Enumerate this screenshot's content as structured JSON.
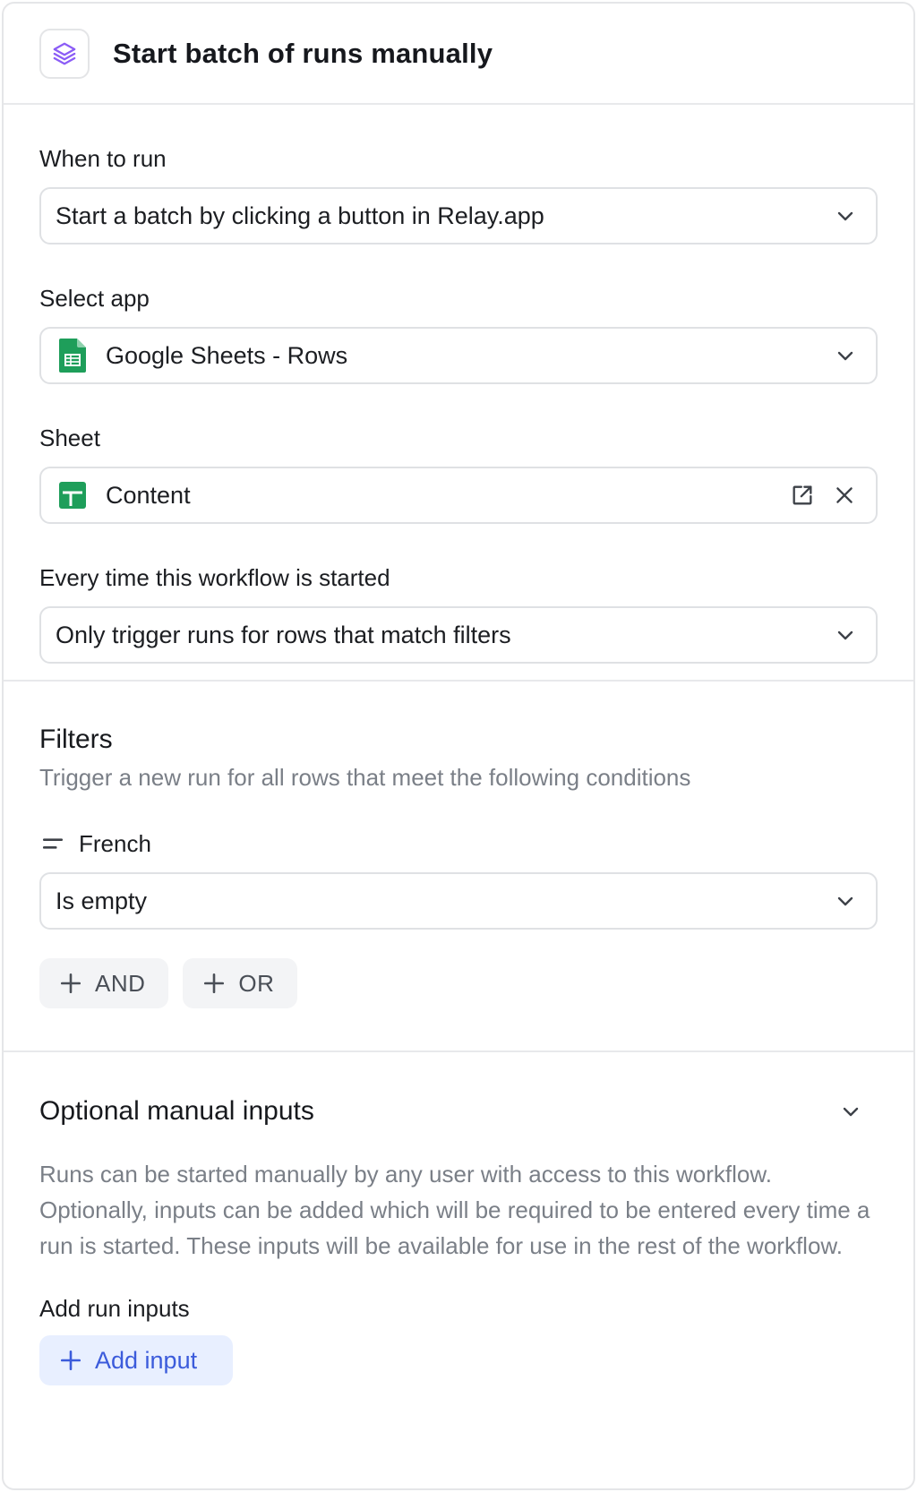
{
  "header": {
    "title": "Start batch of runs manually",
    "icon": "layers-icon"
  },
  "when_to_run": {
    "label": "When to run",
    "value": "Start a batch by clicking a button in Relay.app"
  },
  "select_app": {
    "label": "Select app",
    "value": "Google Sheets - Rows"
  },
  "sheet": {
    "label": "Sheet",
    "value": "Content"
  },
  "every_time": {
    "label": "Every time this workflow is started",
    "value": "Only trigger runs for rows that match filters"
  },
  "filters": {
    "title": "Filters",
    "subtitle": "Trigger a new run for all rows that meet the following conditions",
    "field_name": "French",
    "condition": "Is empty",
    "and_label": "AND",
    "or_label": "OR"
  },
  "optional_inputs": {
    "title": "Optional manual inputs",
    "description": "Runs can be started manually by any user with access to this workflow. Optionally, inputs can be added which will be required to be entered every time a run is started. These inputs will be available for use in the rest of the workflow.",
    "add_label": "Add run inputs",
    "add_button": "Add input"
  },
  "colors": {
    "accent_purple": "#8b5cf6",
    "sheets_green": "#1e9e5a",
    "link_blue": "#3b5bdb",
    "muted_text": "#7a7f87"
  }
}
